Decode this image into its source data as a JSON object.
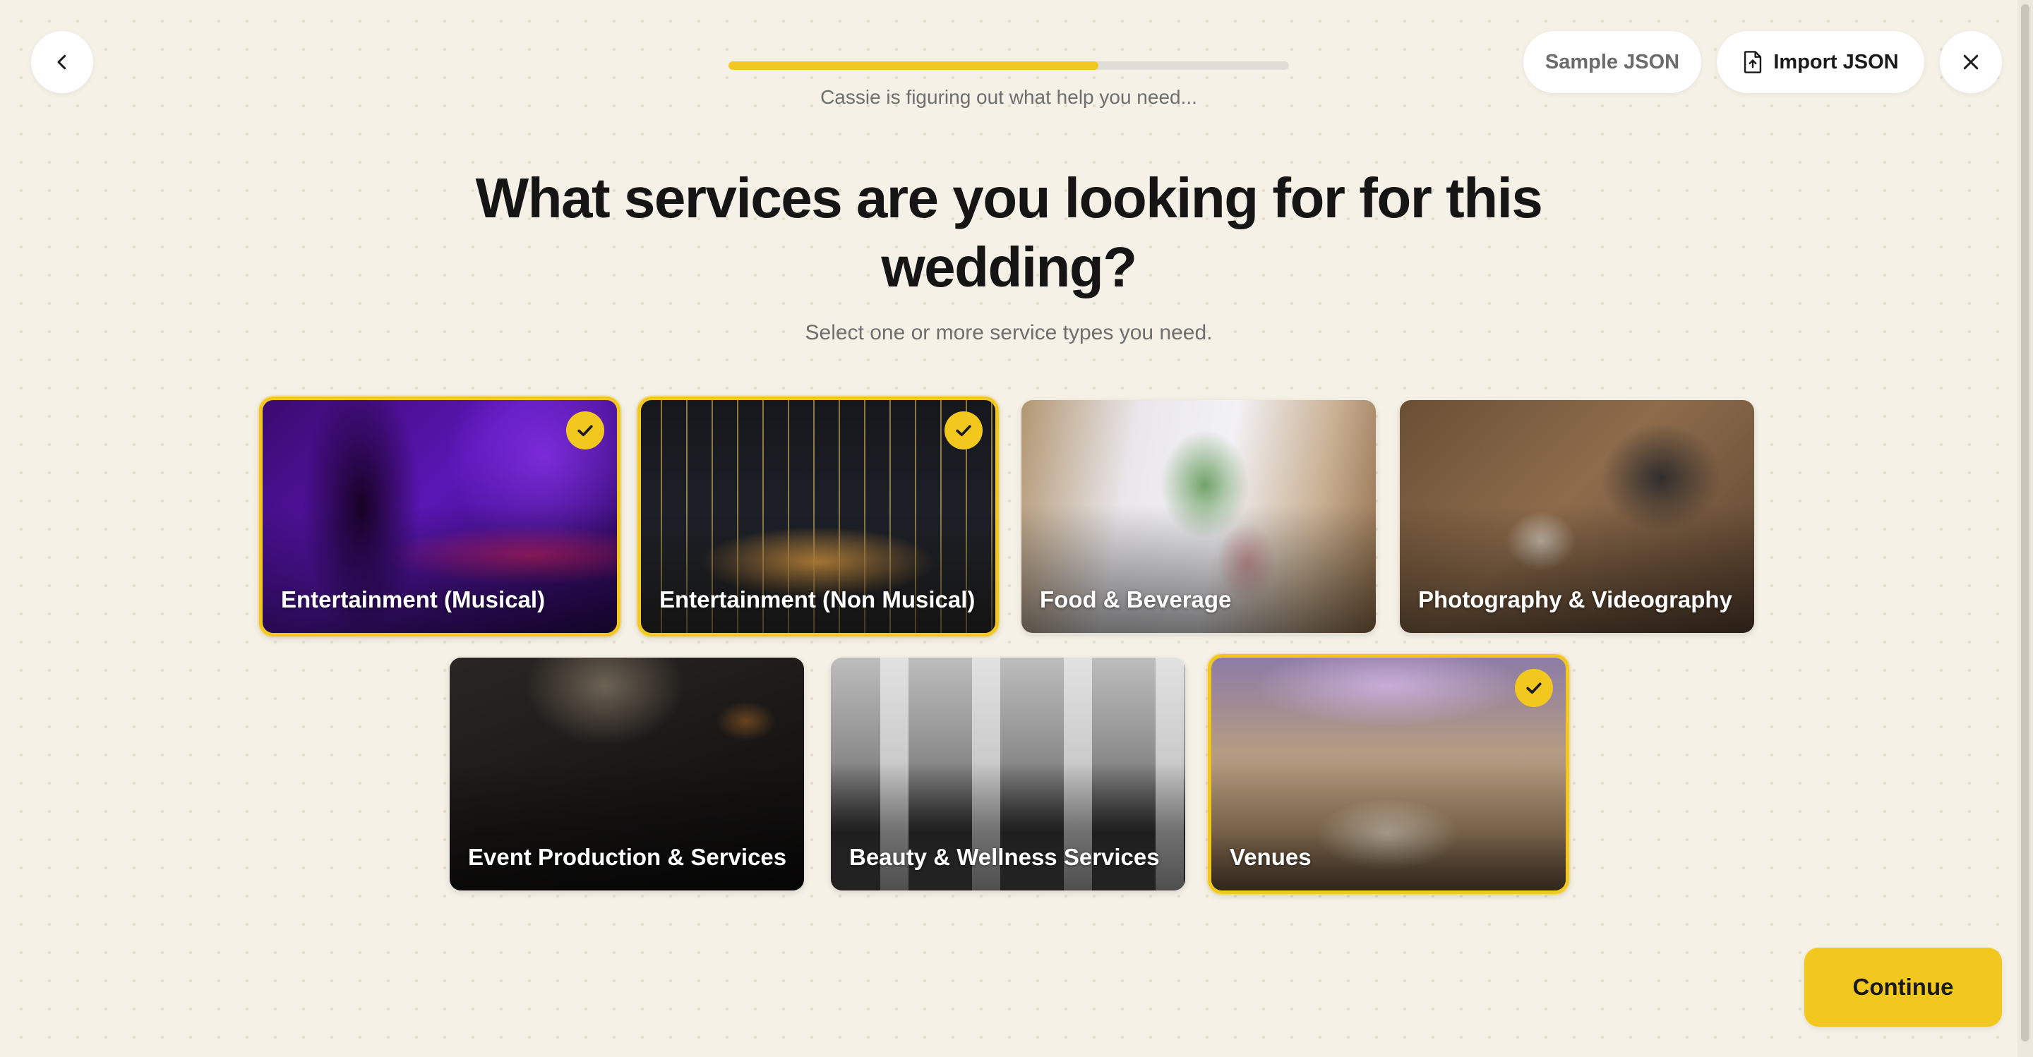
{
  "nav": {
    "back_icon": "chevron-left-icon",
    "close_icon": "close-icon",
    "sample_json_label": "Sample JSON",
    "import_json_label": "Import JSON",
    "import_icon": "file-upload-icon"
  },
  "progress": {
    "value": 0.66,
    "text": "Cassie is figuring out what help you need..."
  },
  "question": {
    "title": "What services are you looking for for this wedding?",
    "subtitle": "Select one or more service types you need."
  },
  "services": [
    {
      "label": "Entertainment (Musical)",
      "selected": true,
      "image": "dj-turntable"
    },
    {
      "label": "Entertainment (Non Musical)",
      "selected": true,
      "image": "birthday-candles-cake"
    },
    {
      "label": "Food & Beverage",
      "selected": false,
      "image": "banquet-table"
    },
    {
      "label": "Photography & Videography",
      "selected": false,
      "image": "vintage-camera"
    },
    {
      "label": "Event Production & Services",
      "selected": false,
      "image": "concert-crowd"
    },
    {
      "label": "Beauty & Wellness Services",
      "selected": false,
      "image": "salon-interior"
    },
    {
      "label": "Venues",
      "selected": true,
      "image": "ballroom"
    }
  ],
  "actions": {
    "continue_label": "Continue"
  },
  "colors": {
    "accent": "#f2c81f",
    "background": "#f5f1e6"
  }
}
